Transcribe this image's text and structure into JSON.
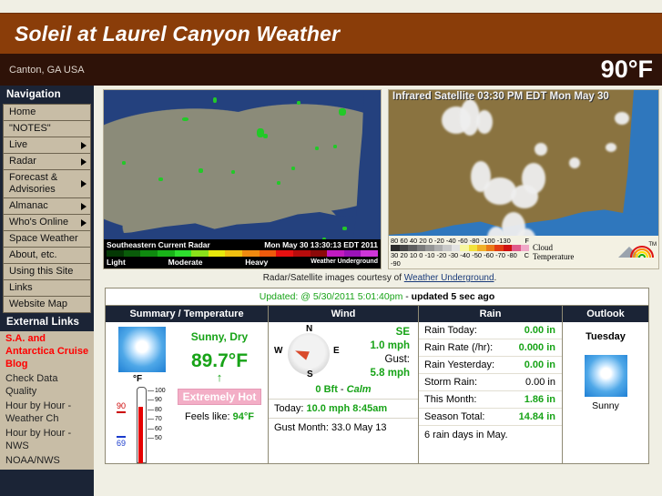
{
  "header": {
    "site_title": "Soleil at Laurel Canyon Weather",
    "location": "Canton, GA USA",
    "current_temp": "90°F"
  },
  "sidebar": {
    "nav_heading": "Navigation",
    "nav_items": [
      {
        "label": "Home",
        "has_submenu": false
      },
      {
        "label": "\"NOTES\"",
        "has_submenu": false
      },
      {
        "label": "Live",
        "has_submenu": true
      },
      {
        "label": "Radar",
        "has_submenu": true
      },
      {
        "label": "Forecast & Advisories",
        "has_submenu": true
      },
      {
        "label": "Almanac",
        "has_submenu": true
      },
      {
        "label": "Who's Online",
        "has_submenu": true
      },
      {
        "label": "Space Weather",
        "has_submenu": false
      },
      {
        "label": "About, etc.",
        "has_submenu": false
      },
      {
        "label": "Using this Site",
        "has_submenu": false
      },
      {
        "label": "Links",
        "has_submenu": false
      },
      {
        "label": "Website Map",
        "has_submenu": false
      }
    ],
    "external_heading": "External Links",
    "external_items": [
      {
        "label": "S.A. and Antarctica Cruise Blog",
        "highlight": true
      },
      {
        "label": "Check Data Quality",
        "highlight": false
      },
      {
        "label": "Hour by Hour - Weather Ch",
        "highlight": false
      },
      {
        "label": "Hour by Hour - NWS",
        "highlight": false
      },
      {
        "label": "NOAA/NWS",
        "highlight": false
      }
    ]
  },
  "radar": {
    "title": "Southeastern Current Radar",
    "timestamp": "Mon May 30 13:30:13 EDT 2011",
    "legend_light": "Light",
    "legend_moderate": "Moderate",
    "legend_heavy": "Heavy",
    "provider": "Weather Underground",
    "provider_url_text": "wunderground.com"
  },
  "satellite": {
    "title": "Infrared Satellite 03:30 PM EDT Mon May 30",
    "scale_f_labels": "80  60  40  20   0  -20 -40 -60 -80 -100  -130",
    "scale_f_unit": "F",
    "scale_c_labels": "30  20  10   0  -10 -20 -30 -40 -50 -60 -70 -80 -90",
    "scale_c_unit": "C",
    "scale_label_line1": "Cloud",
    "scale_label_line2": "Temperature",
    "logo_tm": "TM"
  },
  "courtesy": {
    "text_before": "Radar/Satellite images courtesy of ",
    "link_text": "Weather Underground",
    "text_after": "."
  },
  "updated": {
    "prefix": "Updated: @ 5/30/2011 5:01:40pm",
    "separator": " - ",
    "suffix": "updated 5 sec ago"
  },
  "table": {
    "headers": {
      "summary": "Summary / Temperature",
      "wind": "Wind",
      "rain": "Rain",
      "outlook": "Outlook"
    },
    "summary": {
      "icon": "sunny-icon",
      "condition": "Sunny, Dry",
      "temperature": "89.7°F",
      "trend_arrow": "↑",
      "heat_badge": "Extremely Hot",
      "feels_like_label": "Feels like:",
      "feels_like_value": "94°F",
      "thermometer": {
        "unit": "°F",
        "high": "90",
        "low": "69",
        "ticks": [
          "100",
          "90",
          "80",
          "70",
          "60",
          "50"
        ]
      }
    },
    "wind": {
      "compass": {
        "n": "N",
        "e": "E",
        "s": "S",
        "w": "W"
      },
      "direction": "SE",
      "speed": "1.0 mph",
      "gust_label": "Gust:",
      "gust_speed": "5.8 mph",
      "beaufort": "0 Bft",
      "beaufort_sep": " - ",
      "beaufort_desc": "Calm",
      "today_label": "Today:",
      "today_value": "10.0 mph 8:45am",
      "gust_month_label": "Gust Month:",
      "gust_month_value": "33.0 May 13"
    },
    "rain": {
      "rows": [
        {
          "label": "Rain Today:",
          "value": "0.00 in",
          "green": true
        },
        {
          "label": "Rain Rate (/hr):",
          "value": "0.000 in",
          "green": true
        },
        {
          "label": "Rain Yesterday:",
          "value": "0.00 in",
          "green": true
        },
        {
          "label": "Storm Rain:",
          "value": "0.00 in",
          "green": false
        },
        {
          "label": "This Month:",
          "value": "1.86 in",
          "green": true
        },
        {
          "label": "Season Total:",
          "value": "14.84 in",
          "green": true
        }
      ],
      "note": "6 rain days in May."
    },
    "outlook": {
      "day": "Tuesday",
      "icon": "sunny-icon",
      "caption": "Sunny"
    }
  },
  "colors": {
    "banner_brown": "#8a3d09",
    "subbanner_dark": "#2e1208",
    "sidebar_navy": "#1b2436",
    "menu_tan": "#c8bda6",
    "value_green": "#17a317",
    "link_red": "#ff0000",
    "page_bg": "#f0efe4"
  }
}
